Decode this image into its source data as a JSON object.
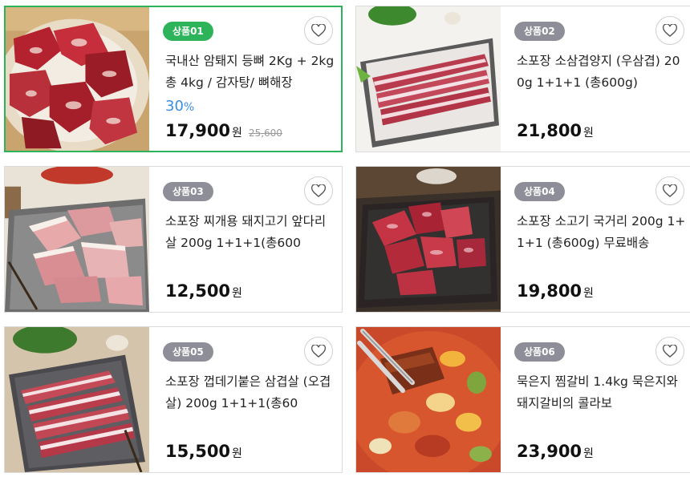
{
  "products": [
    {
      "badge": "상품01",
      "title": "국내산 암퇘지 등뼈 2Kg + 2kg 총 4kg / 감자탕/ 뼈해장",
      "discount": "30",
      "discount_unit": "%",
      "price": "17,900",
      "currency": "원",
      "original_price": "25,600",
      "image": "pork-neck-bones"
    },
    {
      "badge": "상품02",
      "title": "소포장 소삼겹양지 (우삼겹) 200g 1+1+1 (총600g)",
      "price": "21,800",
      "currency": "원",
      "image": "beef-brisket-slices"
    },
    {
      "badge": "상품03",
      "title": "소포장 찌개용 돼지고기 앞다리살 200g 1+1+1(총600",
      "price": "12,500",
      "currency": "원",
      "image": "pork-shoulder-chunks"
    },
    {
      "badge": "상품04",
      "title": "소포장 소고기 국거리 200g 1+1+1 (총600g) 무료배송",
      "price": "19,800",
      "currency": "원",
      "image": "beef-soup-cubes"
    },
    {
      "badge": "상품05",
      "title": "소포장 껍데기붙은 삼겹살 (오겹살) 200g 1+1+1(총60",
      "price": "15,500",
      "currency": "원",
      "image": "pork-belly-skin-on"
    },
    {
      "badge": "상품06",
      "title": "묵은지 찜갈비 1.4kg 묵은지와 돼지갈비의 콜라보",
      "price": "23,900",
      "currency": "원",
      "image": "kimchi-braised-ribs"
    }
  ],
  "colors": {
    "active_border": "#2db45a",
    "badge_active": "#2db45a",
    "badge_default": "#8e8e98",
    "discount": "#3b8ee0"
  },
  "icons": {
    "wishlist": "heart-outline-icon"
  }
}
